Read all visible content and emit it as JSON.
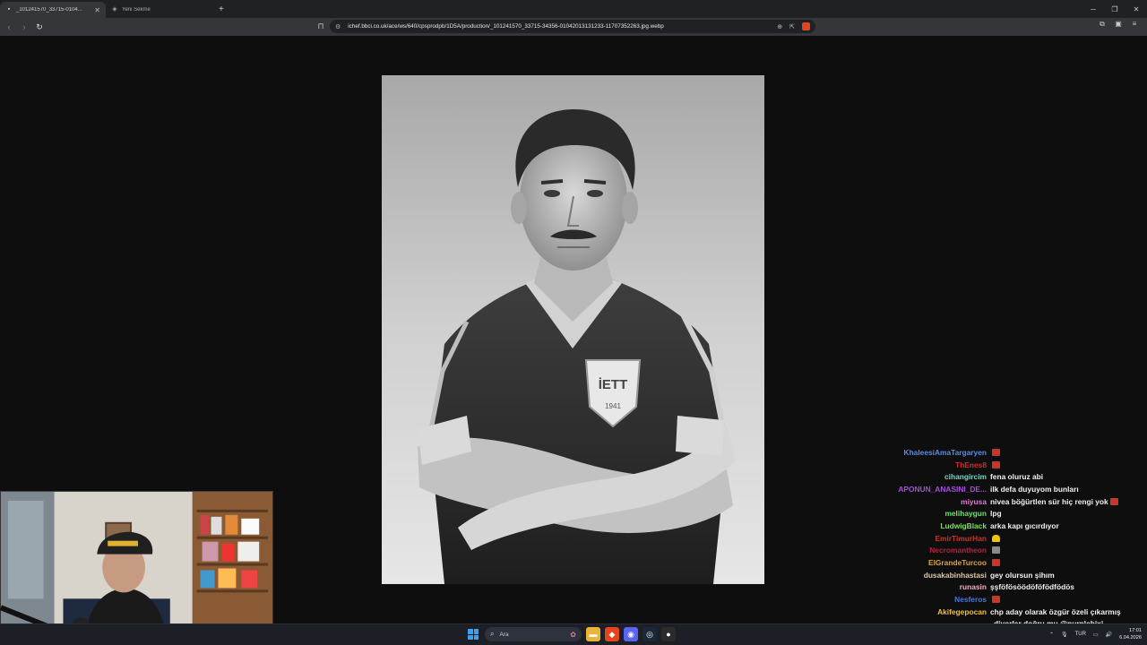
{
  "browser": {
    "tabs": [
      {
        "title": "_101241570_33715-0104...",
        "active": true,
        "icon": "image-file-icon"
      },
      {
        "title": "Yeni Sekme",
        "active": false,
        "icon": "brave-shield-icon"
      }
    ],
    "new_tab_symbol": "+",
    "url": "ichef.bbci.co.uk/ace/ws/640/cpsprodpb/1D5A/production/_101241570_33715-34356-01042013131233-11707352263.jpg.webp",
    "window_controls": [
      "─",
      "❐",
      "✕"
    ]
  },
  "photo": {
    "crest_text": "İETT",
    "crest_year": "1941"
  },
  "chat": {
    "messages": [
      {
        "user": "KhaleesiAmaTargaryen",
        "color": "#5b8de0",
        "text": "",
        "emote": "red"
      },
      {
        "user": "ThEnes8",
        "color": "#d12d2d",
        "text": "",
        "emote": "red"
      },
      {
        "user": "cihangircim",
        "color": "#7ad4c6",
        "text": "fena oluruz abi",
        "emote": ""
      },
      {
        "user": "APONUN_ANASINI_DE...",
        "color": "#a94fe0",
        "text": "ilk defa duyuyom bunları",
        "emote": ""
      },
      {
        "user": "miyusa",
        "color": "#e27ad7",
        "text": "nivea böğürtlen sür hiç rengi yok",
        "emote": "red"
      },
      {
        "user": "melihaygun",
        "color": "#6fe06f",
        "text": "lpg",
        "emote": ""
      },
      {
        "user": "LudwigBlack",
        "color": "#7be05c",
        "text": "arka kapı gıcırdıyor",
        "emote": ""
      },
      {
        "user": "EmirTimurHan",
        "color": "#c0392b",
        "text": "",
        "emote": "bell"
      },
      {
        "user": "Necromantheon",
        "color": "#b3243a",
        "text": "",
        "emote": "gray"
      },
      {
        "user": "ElGrandeTurcoo",
        "color": "#e0a23a",
        "text": "",
        "emote": "red"
      },
      {
        "user": "dusakabinhastasi",
        "color": "#d9c8a8",
        "text": "gey olursun şihım",
        "emote": ""
      },
      {
        "user": "runasin",
        "color": "#f0b0c0",
        "text": "şşföfösöödöföfödfödös",
        "emote": ""
      },
      {
        "user": "Nesferos",
        "color": "#4a78d8",
        "text": "",
        "emote": "red"
      },
      {
        "user": "Akifegepocan",
        "color": "#f0c040",
        "text": "chp aday olarak özgür özeli çıkarmış",
        "emote": ""
      },
      {
        "user": "",
        "color": "#f0c040",
        "text": "diyorlar doğru mu @purplebixi",
        "emote": ""
      }
    ]
  },
  "taskbar": {
    "search_placeholder": "Ara",
    "language": "TUR",
    "time": "17:01",
    "date": "6.04.2026",
    "tray_up_arrow": "⌃",
    "mic_icon": "🎙",
    "wifi_icon": "▭",
    "volume_icon": "🔊"
  }
}
